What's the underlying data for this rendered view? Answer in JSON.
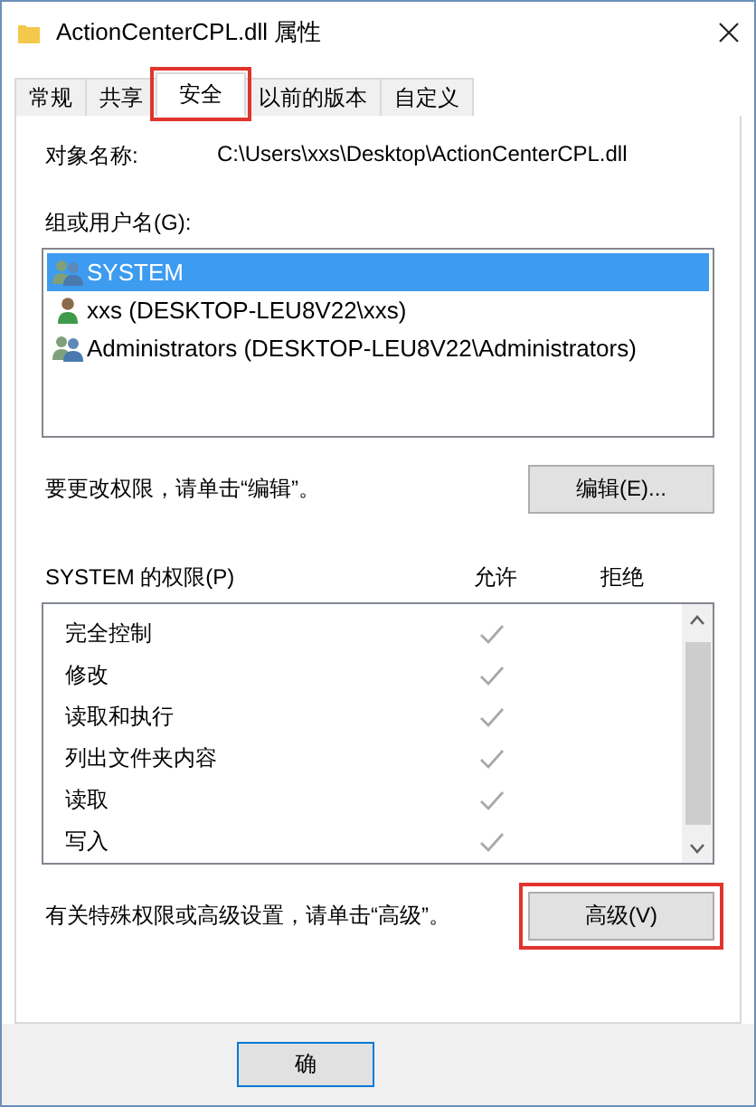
{
  "window": {
    "title": "ActionCenterCPL.dll 属性"
  },
  "tabs": [
    {
      "label": "常规",
      "selected": false,
      "highlighted": false
    },
    {
      "label": "共享",
      "selected": false,
      "highlighted": false
    },
    {
      "label": "安全",
      "selected": true,
      "highlighted": true
    },
    {
      "label": "以前的版本",
      "selected": false,
      "highlighted": false
    },
    {
      "label": "自定义",
      "selected": false,
      "highlighted": false
    }
  ],
  "object_name": {
    "label": "对象名称:",
    "value": "C:\\Users\\xxs\\Desktop\\ActionCenterCPL.dll"
  },
  "users": {
    "label": "组或用户名(G):",
    "items": [
      {
        "kind": "group",
        "name": "SYSTEM",
        "selected": true
      },
      {
        "kind": "user",
        "name": "xxs (DESKTOP-LEU8V22\\xxs)",
        "selected": false
      },
      {
        "kind": "group",
        "name": "Administrators (DESKTOP-LEU8V22\\Administrators)",
        "selected": false
      }
    ]
  },
  "edit": {
    "note": "要更改权限，请单击“编辑”。",
    "button": "编辑(E)...",
    "highlighted": false
  },
  "permissions": {
    "label": "SYSTEM 的权限(P)",
    "allow_header": "允许",
    "deny_header": "拒绝",
    "rows": [
      {
        "name": "完全控制",
        "allow": true,
        "deny": false
      },
      {
        "name": "修改",
        "allow": true,
        "deny": false
      },
      {
        "name": "读取和执行",
        "allow": true,
        "deny": false
      },
      {
        "name": "列出文件夹内容",
        "allow": true,
        "deny": false
      },
      {
        "name": "读取",
        "allow": true,
        "deny": false
      },
      {
        "name": "写入",
        "allow": true,
        "deny": false
      }
    ]
  },
  "advanced": {
    "note": "有关特殊权限或高级设置，请单击“高级”。",
    "button": "高级(V)",
    "highlighted": true
  },
  "footer_buttons": [
    {
      "label": "确"
    }
  ]
}
